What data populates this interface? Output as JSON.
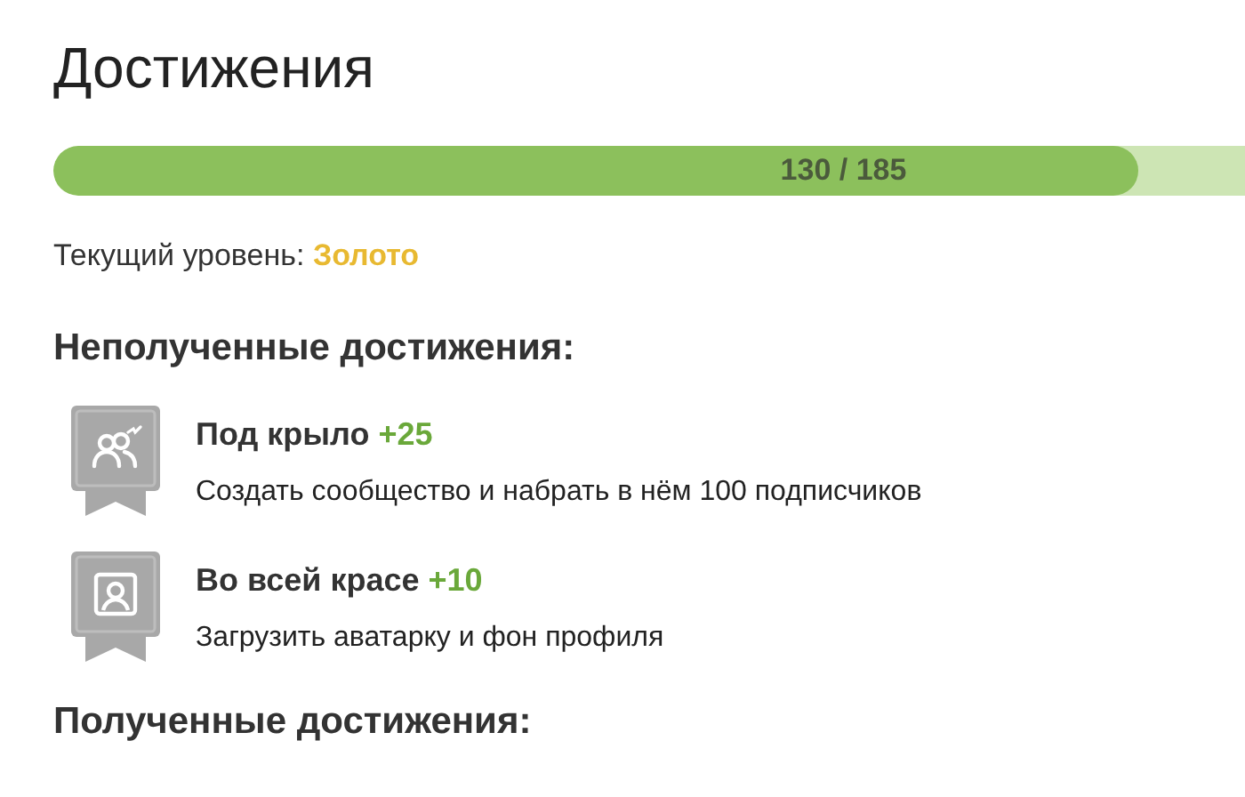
{
  "title": "Достижения",
  "progress": {
    "level": 0.91,
    "reading": "130 / 185"
  },
  "current_level": {
    "label": "Текущий уровень:",
    "value": "Золото"
  },
  "sections": [
    {
      "heading": "Неполученные достижения:",
      "achievements": [
        {
          "kind": "community",
          "name": "Под крыло",
          "points": "+25",
          "description": "Создать сообщество и набрать в нём 100 подписчиков"
        },
        {
          "kind": "profile",
          "name": "Во всей красе",
          "points": "+10",
          "description": "Загрузить аватарку и фон профиля"
        }
      ]
    },
    {
      "heading": "Полученные достижения:"
    }
  ]
}
